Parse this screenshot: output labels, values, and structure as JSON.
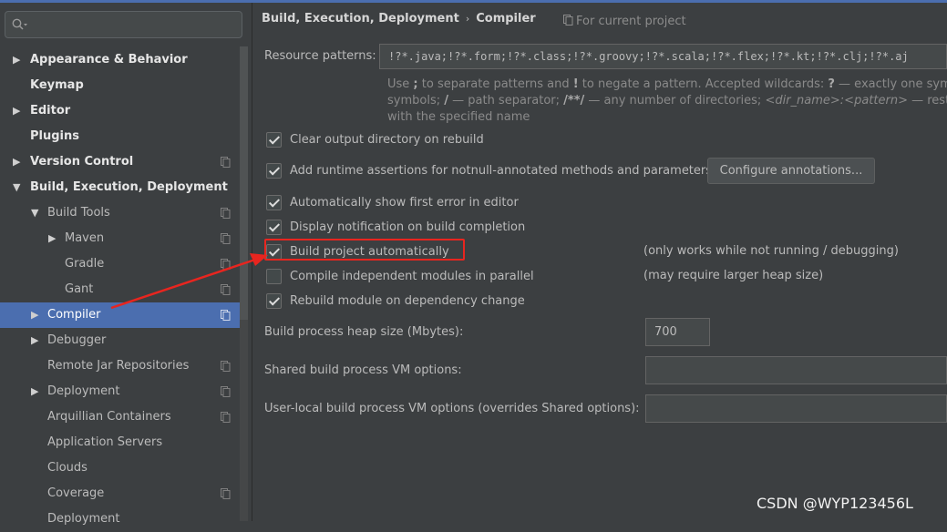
{
  "colors": {
    "selection": "#4b6eaf",
    "annotation": "#e8251f",
    "background": "#3c3f41"
  },
  "sidebar": {
    "search_placeholder": "",
    "items": [
      {
        "label": "Appearance & Behavior",
        "bold": true,
        "arrow": "collapsed",
        "level": 0,
        "project_icon": false
      },
      {
        "label": "Keymap",
        "bold": true,
        "arrow": "none",
        "level": 0,
        "project_icon": false
      },
      {
        "label": "Editor",
        "bold": true,
        "arrow": "collapsed",
        "level": 0,
        "project_icon": false
      },
      {
        "label": "Plugins",
        "bold": true,
        "arrow": "none",
        "level": 0,
        "project_icon": false
      },
      {
        "label": "Version Control",
        "bold": true,
        "arrow": "collapsed",
        "level": 0,
        "project_icon": true
      },
      {
        "label": "Build, Execution, Deployment",
        "bold": true,
        "arrow": "expanded",
        "level": 0,
        "project_icon": false
      },
      {
        "label": "Build Tools",
        "bold": false,
        "arrow": "expanded",
        "level": 1,
        "project_icon": true
      },
      {
        "label": "Maven",
        "bold": false,
        "arrow": "collapsed",
        "level": 2,
        "project_icon": true
      },
      {
        "label": "Gradle",
        "bold": false,
        "arrow": "none",
        "level": 2,
        "project_icon": true
      },
      {
        "label": "Gant",
        "bold": false,
        "arrow": "none",
        "level": 2,
        "project_icon": true
      },
      {
        "label": "Compiler",
        "bold": false,
        "arrow": "collapsed",
        "level": 1,
        "project_icon": true,
        "selected": true
      },
      {
        "label": "Debugger",
        "bold": false,
        "arrow": "collapsed",
        "level": 1,
        "project_icon": false
      },
      {
        "label": "Remote Jar Repositories",
        "bold": false,
        "arrow": "none",
        "level": 1,
        "project_icon": true
      },
      {
        "label": "Deployment",
        "bold": false,
        "arrow": "collapsed",
        "level": 1,
        "project_icon": true
      },
      {
        "label": "Arquillian Containers",
        "bold": false,
        "arrow": "none",
        "level": 1,
        "project_icon": true
      },
      {
        "label": "Application Servers",
        "bold": false,
        "arrow": "none",
        "level": 1,
        "project_icon": false
      },
      {
        "label": "Clouds",
        "bold": false,
        "arrow": "none",
        "level": 1,
        "project_icon": false
      },
      {
        "label": "Coverage",
        "bold": false,
        "arrow": "none",
        "level": 1,
        "project_icon": true
      },
      {
        "label": "Deployment",
        "bold": false,
        "arrow": "none",
        "level": 1,
        "project_icon": false
      }
    ]
  },
  "header": {
    "crumb_parent": "Build, Execution, Deployment",
    "crumb_sep": "›",
    "crumb_current": "Compiler",
    "for_project": "For current project"
  },
  "resource": {
    "label": "Resource patterns:",
    "value": "!?*.java;!?*.form;!?*.class;!?*.groovy;!?*.scala;!?*.flex;!?*.kt;!?*.clj;!?*.aj",
    "hint_l1_a": "Use ",
    "hint_l1_b": ";",
    "hint_l1_c": " to separate patterns and ",
    "hint_l1_d": "!",
    "hint_l1_e": " to negate a pattern. Accepted wildcards: ",
    "hint_l1_f": "?",
    "hint_l1_g": " — exactly one symbol; ",
    "hint_l2_a": "symbols; ",
    "hint_l2_b": "/",
    "hint_l2_c": " — path separator; ",
    "hint_l2_d": "/**/",
    "hint_l2_e": " — any number of directories; ",
    "hint_l2_f": "<dir_name>:<pattern>",
    "hint_l2_g": " — restrict",
    "hint_l3": "with the specified name"
  },
  "options": {
    "clear_output": {
      "label": "Clear output directory on rebuild",
      "checked": true
    },
    "add_assertions": {
      "label": "Add runtime assertions for notnull-annotated methods and parameters",
      "checked": true
    },
    "configure_btn": "Configure annotations...",
    "show_error": {
      "label": "Automatically show first error in editor",
      "checked": true
    },
    "display_notification": {
      "label": "Display notification on build completion",
      "checked": true
    },
    "build_auto": {
      "label": "Build project automatically",
      "checked": true,
      "note": "(only works while not running / debugging)"
    },
    "parallel": {
      "label": "Compile independent modules in parallel",
      "checked": false,
      "note": "(may require larger heap size)"
    },
    "rebuild_dep": {
      "label": "Rebuild module on dependency change",
      "checked": true
    }
  },
  "heap": {
    "label": "Build process heap size (Mbytes):",
    "value": "700"
  },
  "shared_vm": {
    "label": "Shared build process VM options:",
    "value": ""
  },
  "user_vm": {
    "label": "User-local build process VM options (overrides Shared options):",
    "value": ""
  },
  "watermark": "CSDN @WYP123456L"
}
